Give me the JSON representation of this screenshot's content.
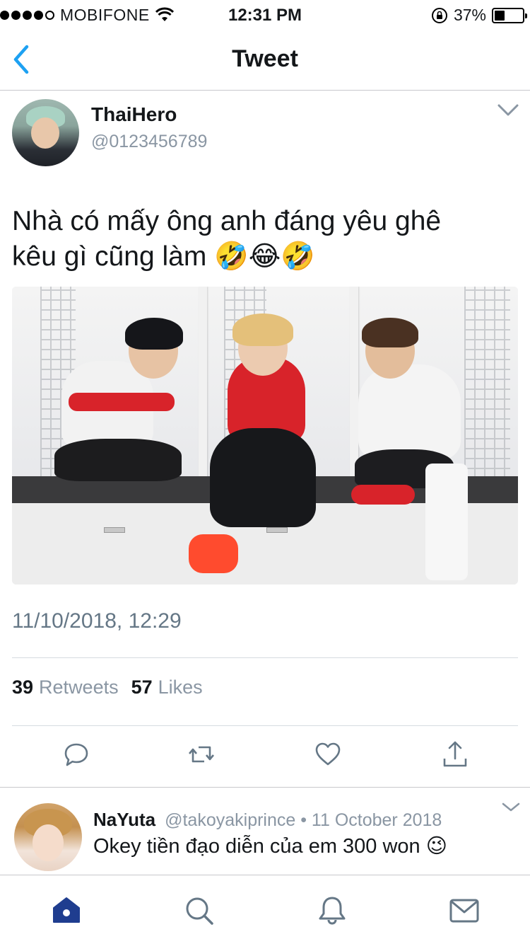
{
  "status_bar": {
    "carrier": "MOBIFONE",
    "time": "12:31 PM",
    "battery": "37%",
    "battery_level": 0.37,
    "signal_bars_filled": 4,
    "signal_bars_total": 5
  },
  "nav": {
    "title": "Tweet",
    "back_icon": "chevron-left-icon"
  },
  "tweet": {
    "author_name": "ThaiHero",
    "author_handle": "@0123456789",
    "text_line1": "Nhà có mấy ông anh đáng yêu ghê",
    "text_line2": "kêu gì cũng làm 🤣😂🤣",
    "timestamp": "11/10/2018, 12:29",
    "retweets_count": "39",
    "retweets_label": "Retweets",
    "likes_count": "57",
    "likes_label": "Likes",
    "actions": [
      "reply-icon",
      "retweet-icon",
      "heart-icon",
      "share-icon"
    ]
  },
  "reply": {
    "name": "NaYuta",
    "meta": "@takoyakiprince • 11 October 2018",
    "text": "Okey tiền đạo diễn của em 300 won 😉"
  },
  "tab_bar": {
    "items": [
      "home-icon",
      "search-icon",
      "notifications-icon",
      "messages-icon"
    ]
  },
  "colors": {
    "accent": "#1da1f2",
    "home_active": "#1f3d8f",
    "icon_gray": "#657786",
    "text_gray": "#8a96a3"
  }
}
